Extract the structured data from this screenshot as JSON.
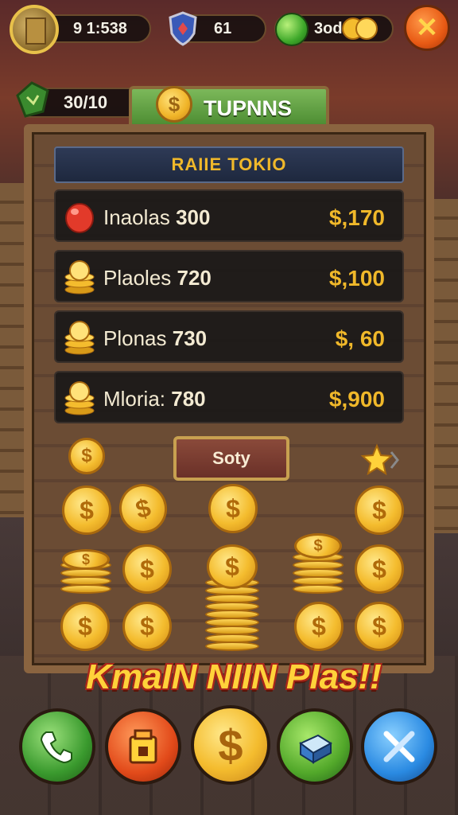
{
  "hud": {
    "gold_counter": "9 1:538",
    "shield_counter": "61",
    "coin_counter": "3od"
  },
  "level": {
    "value": "30/10",
    "turns_label": "TUPNNS"
  },
  "panel": {
    "title": "RAIIE TOKIO",
    "rows": [
      {
        "name": "Inaolas",
        "qty": "300",
        "price": "$,170",
        "icon": "red-gem-icon"
      },
      {
        "name": "Plaoles",
        "qty": "720",
        "price": "$,100",
        "icon": "coin-stack-icon"
      },
      {
        "name": "Plonas",
        "qty": "730",
        "price": "$, 60",
        "icon": "coin-stack-icon"
      },
      {
        "name": "Mloria:",
        "qty": "780",
        "price": "$,900",
        "icon": "coin-stack-icon"
      }
    ],
    "sort_label": "Soty"
  },
  "banner": "KmaIN NIIN PIas!!",
  "coin_symbol": "$",
  "bottom_bar": [
    {
      "name": "phone-button",
      "icon": "phone-icon"
    },
    {
      "name": "shop-button",
      "icon": "shop-icon"
    },
    {
      "name": "coin-button",
      "icon": "coin-icon"
    },
    {
      "name": "box-button",
      "icon": "box-icon"
    },
    {
      "name": "tools-button",
      "icon": "tools-icon"
    }
  ],
  "colors": {
    "accent_gold": "#f0b82a",
    "banner_red": "#a8261a",
    "turns_green": "#4a8a30"
  }
}
